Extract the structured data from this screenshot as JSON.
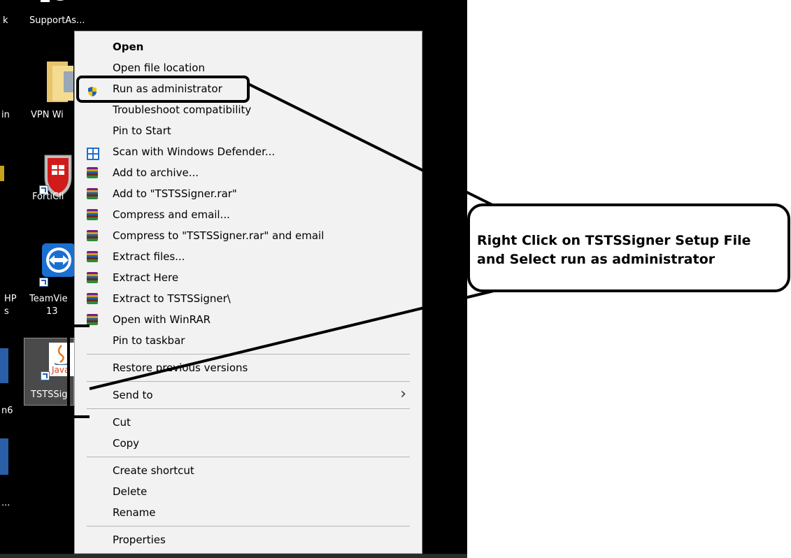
{
  "desktop": {
    "icons": [
      {
        "label": "SupportAs...",
        "icon": "supportassist-icon"
      },
      {
        "label": "VPN Wi",
        "icon": "folder-icon"
      },
      {
        "label": "FortiCli",
        "icon": "forticlient-icon"
      },
      {
        "label": "TeamVie",
        "label2": "13",
        "icon": "teamviewer-icon"
      },
      {
        "label": "TSTSSig",
        "icon": "java-icon",
        "java_text": "Java"
      }
    ],
    "edge_labels": {
      "a": "k",
      "b": "in",
      "c": "HP",
      "d": "s",
      "e": "n6",
      "f": "..."
    }
  },
  "context_menu": {
    "items": [
      {
        "label": "Open",
        "bold": true,
        "icon": ""
      },
      {
        "label": "Open file location",
        "icon": ""
      },
      {
        "label": "Run as administrator",
        "icon": "uac-shield-icon"
      },
      {
        "label": "Troubleshoot compatibility",
        "icon": ""
      },
      {
        "label": "Pin to Start",
        "icon": ""
      },
      {
        "label": "Scan with Windows Defender...",
        "icon": "windows-defender-icon"
      },
      {
        "label": "Add to archive...",
        "icon": "winrar-icon"
      },
      {
        "label": "Add to \"TSTSSigner.rar\"",
        "icon": "winrar-icon"
      },
      {
        "label": "Compress and email...",
        "icon": "winrar-icon"
      },
      {
        "label": "Compress to \"TSTSSigner.rar\" and email",
        "icon": "winrar-icon"
      },
      {
        "label": "Extract files...",
        "icon": "winrar-icon"
      },
      {
        "label": "Extract Here",
        "icon": "winrar-icon"
      },
      {
        "label": "Extract to TSTSSigner\\",
        "icon": "winrar-icon"
      },
      {
        "label": "Open with WinRAR",
        "icon": "winrar-icon"
      },
      {
        "label": "Pin to taskbar",
        "icon": ""
      },
      {
        "label": "Restore previous versions",
        "icon": ""
      },
      {
        "label": "Send to",
        "icon": "",
        "submenu": true,
        "submenu_glyph": "›"
      },
      {
        "label": "Cut",
        "icon": ""
      },
      {
        "label": "Copy",
        "icon": ""
      },
      {
        "label": "Create shortcut",
        "icon": ""
      },
      {
        "label": "Delete",
        "icon": ""
      },
      {
        "label": "Rename",
        "icon": ""
      },
      {
        "label": "Properties",
        "icon": ""
      }
    ]
  },
  "callout": {
    "line1": "Right Click on TSTSSigner Setup File",
    "line2": "and Select run as administrator"
  },
  "colors": {
    "accent": "#1e5fbf",
    "desktop_bg": "#000000",
    "menu_bg": "#f2f2f2"
  }
}
